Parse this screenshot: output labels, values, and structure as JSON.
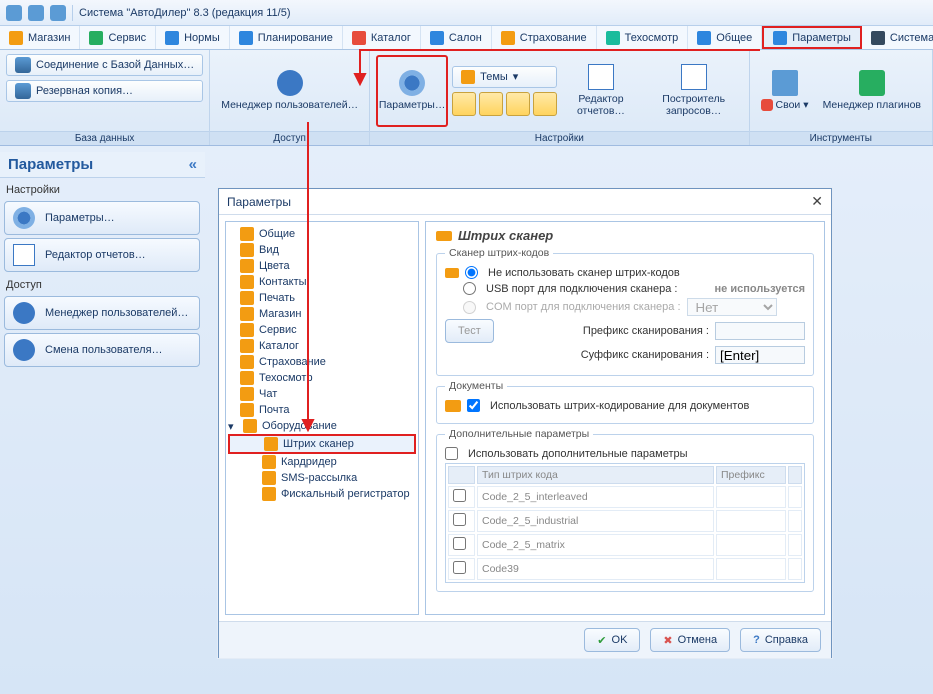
{
  "app": {
    "title": "Система \"АвтоДилер\" 8.3 (редакция 11/5)"
  },
  "tabs": [
    {
      "label": "Магазин",
      "color": "ti-orange"
    },
    {
      "label": "Сервис",
      "color": "ti-green"
    },
    {
      "label": "Нормы",
      "color": "ti-blue"
    },
    {
      "label": "Планирование",
      "color": "ti-blue"
    },
    {
      "label": "Каталог",
      "color": "ti-red"
    },
    {
      "label": "Салон",
      "color": "ti-blue"
    },
    {
      "label": "Страхование",
      "color": "ti-orange"
    },
    {
      "label": "Техосмотр",
      "color": "ti-teal"
    },
    {
      "label": "Общее",
      "color": "ti-blue"
    },
    {
      "label": "Параметры",
      "color": "ti-blue",
      "active": true
    },
    {
      "label": "Система",
      "color": "ti-navy"
    }
  ],
  "ribbon": {
    "groups": {
      "db": {
        "caption": "База данных",
        "btn_conn": "Соединение с Базой Данных…",
        "btn_backup": "Резервная копия…"
      },
      "access": {
        "caption": "Доступ",
        "btn_usermgr": "Менеджер пользователей…"
      },
      "settings": {
        "caption": "Настройки",
        "btn_params": "Параметры…",
        "btn_themes": "Темы",
        "btn_report": "Редактор отчетов…",
        "btn_query": "Построитель запросов…"
      },
      "tools": {
        "caption": "Инструменты",
        "btn_own": "Свои",
        "btn_plugin": "Менеджер плагинов"
      }
    }
  },
  "leftpanel": {
    "title": "Параметры",
    "grp1": "Настройки",
    "btn_params": "Параметры…",
    "btn_report": "Редактор отчетов…",
    "grp2": "Доступ",
    "btn_usermgr": "Менеджер пользователей…",
    "btn_switch": "Смена пользователя…"
  },
  "dialog": {
    "title": "Параметры",
    "tree": [
      "Общие",
      "Вид",
      "Цвета",
      "Контакты",
      "Печать",
      "Магазин",
      "Сервис",
      "Каталог",
      "Страхование",
      "Техосмотр",
      "Чат",
      "Почта",
      "Оборудование"
    ],
    "tree_children": [
      "Штрих сканер",
      "Кардридер",
      "SMS-рассылка",
      "Фискальный регистратор"
    ],
    "form": {
      "heading": "Штрих сканер",
      "scanner_group": "Сканер штрих-кодов",
      "opt_none": "Не использовать сканер штрих-кодов",
      "opt_usb": "USB порт для подключения сканера :",
      "opt_usb_value": "не используется",
      "opt_com": "COM порт для подключения сканера :",
      "opt_com_value": "Нет",
      "lbl_prefix": "Префикс сканирования :",
      "lbl_suffix": "Суффикс сканирования :",
      "suffix_value": "[Enter]",
      "btn_test": "Тест",
      "docs_group": "Документы",
      "chk_docs": "Использовать штрих-кодирование для документов",
      "extra_group": "Дополнительные параметры",
      "chk_extra": "Использовать дополнительные параметры",
      "tbl_col_type": "Тип штрих кода",
      "tbl_col_prefix": "Префикс",
      "tbl_rows": [
        "Code_2_5_interleaved",
        "Code_2_5_industrial",
        "Code_2_5_matrix",
        "Code39"
      ]
    },
    "footer": {
      "ok": "OK",
      "cancel": "Отмена",
      "help": "Справка"
    }
  }
}
